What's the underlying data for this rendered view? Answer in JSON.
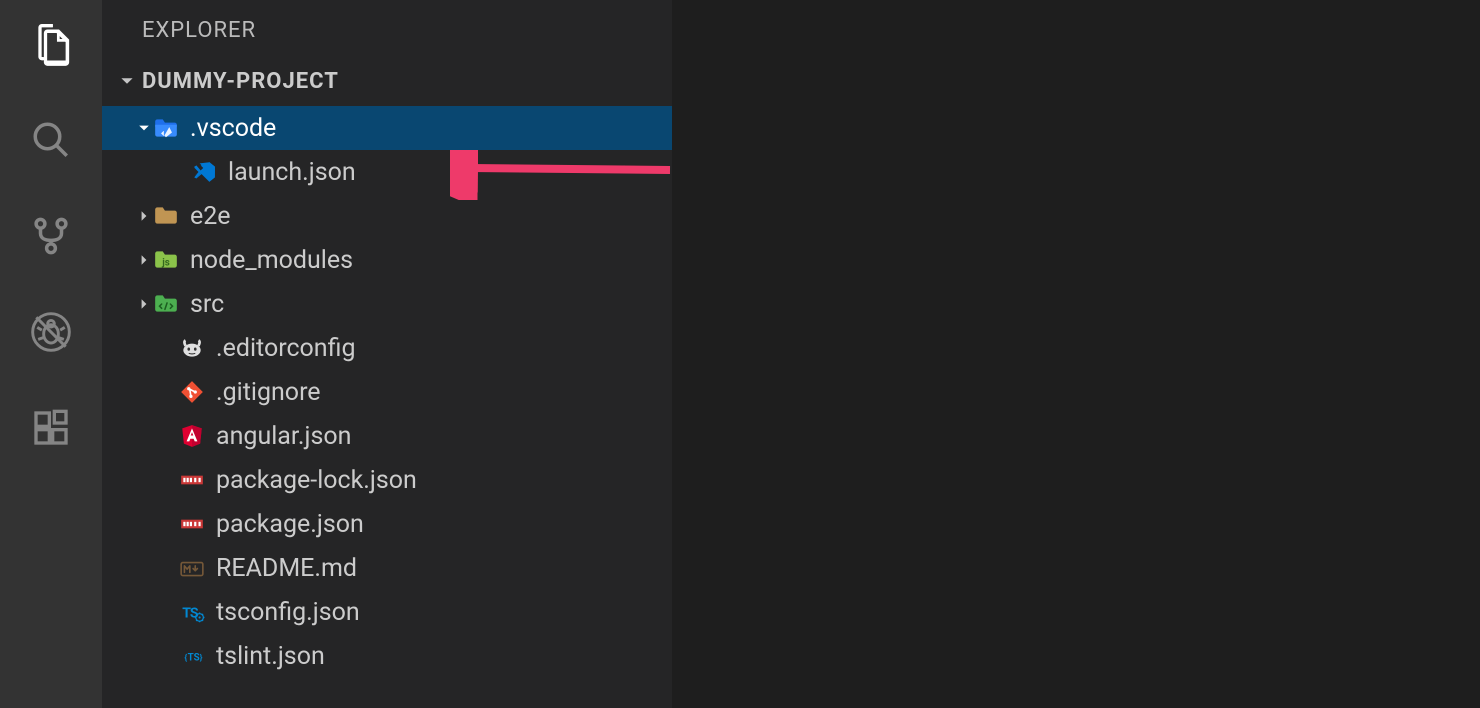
{
  "sidebar": {
    "title": "EXPLORER",
    "project": "DUMMY-PROJECT"
  },
  "tree": {
    "vscode_folder": ".vscode",
    "launch_json": "launch.json",
    "e2e": "e2e",
    "node_modules": "node_modules",
    "src": "src",
    "editorconfig": ".editorconfig",
    "gitignore": ".gitignore",
    "angular_json": "angular.json",
    "package_lock": "package-lock.json",
    "package_json": "package.json",
    "readme": "README.md",
    "tsconfig": "tsconfig.json",
    "tslint": "tslint.json"
  }
}
